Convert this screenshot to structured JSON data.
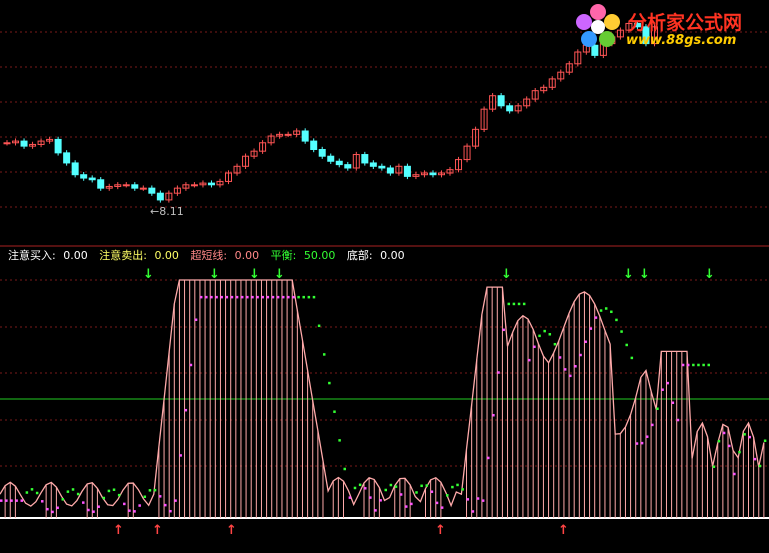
{
  "logo": {
    "title": "分析家公式网",
    "url": "www.88gs.com"
  },
  "price_label": "8.11",
  "legend": {
    "buy_label": "注意买入:",
    "buy_value": "0.00",
    "sell_label": "注意卖出:",
    "sell_value": "0.00",
    "ultra_label": "超短线:",
    "ultra_value": "0.00",
    "balance_label": "平衡:",
    "balance_value": "50.00",
    "bottom_label": "底部:",
    "bottom_value": "0.00"
  },
  "colors": {
    "up": "#ff5555",
    "down": "#54ffff",
    "grid": "#7a1a1a",
    "balance_line": "#22cc22",
    "green": "#33ff33",
    "magenta": "#ff55ff",
    "envelope": "#ffaaaa",
    "buy_arrow": "#ff4444",
    "sell_arrow": "#33ff33"
  },
  "chart_data": {
    "type": "candlestick",
    "candles_start": 8.2,
    "candles_moves": [
      0.0,
      0.05,
      -0.15,
      0.05,
      0.1,
      0.05,
      -0.4,
      -0.3,
      -0.35,
      -0.1,
      -0.05,
      -0.25,
      0.05,
      0.05,
      0.0,
      -0.1,
      0.0,
      -0.15,
      -0.2,
      0.2,
      0.15,
      0.1,
      0.0,
      0.05,
      -0.05,
      0.1,
      0.25,
      0.2,
      0.3,
      0.15,
      0.25,
      0.2,
      0.05,
      0.0,
      0.1,
      -0.3,
      -0.25,
      -0.2,
      -0.15,
      -0.1,
      -0.1,
      0.4,
      -0.25,
      -0.1,
      -0.05,
      -0.15,
      0.2,
      -0.3,
      0.05,
      0.05,
      -0.05,
      0.05,
      0.1,
      0.3,
      0.4,
      0.5,
      0.6,
      0.4,
      -0.3,
      -0.15,
      0.15,
      0.2,
      0.25,
      0.1,
      0.25,
      0.2,
      0.25,
      0.35,
      0.2,
      -0.3,
      0.35,
      0.2,
      0.2,
      0.2,
      -0.1,
      -0.5,
      0.5
    ],
    "indicator": {
      "balance": 50,
      "buy": 0.0,
      "sell": 0.0,
      "ultra": 0.0,
      "bottom": 0.0
    }
  }
}
